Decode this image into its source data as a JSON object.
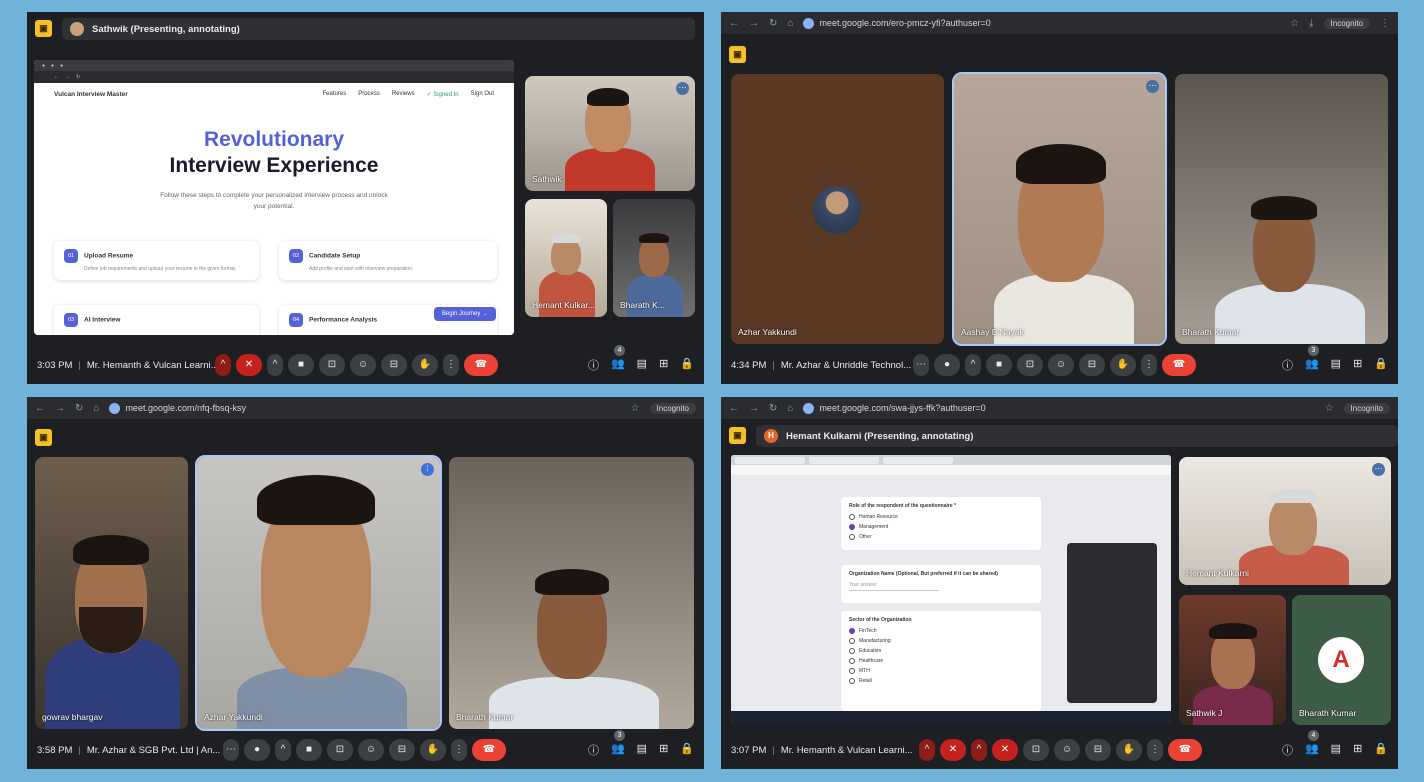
{
  "q1": {
    "presenter_label": "Sathwik (Presenting, annotating)",
    "shared_screen": {
      "brand": "Vulcan Interview Master",
      "nav_links": [
        "Features",
        "Process",
        "Reviews",
        "✓ Signed In",
        "Sign Out"
      ],
      "hero_line1": "Revolutionary",
      "hero_line2": "Interview Experience",
      "subtitle": "Follow these steps to complete your personalized interview process and unlock your potential.",
      "cards": [
        {
          "num": "01",
          "title": "Upload Resume",
          "desc": "Define job requirements and upload your resume in the given format."
        },
        {
          "num": "02",
          "title": "Candidate Setup",
          "desc": "Add profile and start with interview preparation."
        },
        {
          "num": "03",
          "title": "AI Interview",
          "desc": ""
        },
        {
          "num": "04",
          "title": "Performance Analysis",
          "desc": ""
        }
      ],
      "begin_button": "Begin Journey →"
    },
    "tiles": [
      "Sathwik",
      "Hemant Kulkar...",
      "Bharath K..."
    ],
    "time": "3:03 PM",
    "meeting_title": "Mr. Hemanth & Vulcan Learni...",
    "participants_count": "4"
  },
  "q2": {
    "url": "meet.google.com/ero-pmcz-yfi?authuser=0",
    "incognito": "Incognito",
    "tiles": [
      "Azhar Yakkundi",
      "Aashay B Nayak",
      "Bharath Kumar"
    ],
    "time": "4:34 PM",
    "meeting_title": "Mr. Azhar & Unriddle Technol...",
    "participants_count": "3"
  },
  "q3": {
    "url": "meet.google.com/nfq-fbsq-ksy",
    "incognito": "Incognito",
    "tiles": [
      "gowrav bhargav",
      "Azhar Yakkundi",
      "Bharath Kumar"
    ],
    "time": "3:58 PM",
    "meeting_title": "Mr. Azhar & SGB Pvt. Ltd | An...",
    "participants_count": "3"
  },
  "q4": {
    "url": "meet.google.com/swa-jjys-ffk?authuser=0",
    "incognito": "Incognito",
    "presenter_label": "Hemant Kulkarni (Presenting, annotating)",
    "presenter_initial": "H",
    "form": {
      "q_role": "Role of the respondent of the questionnaire *",
      "roles": [
        "Human Resource",
        "Management",
        "Other"
      ],
      "q_org": "Organization Name (Optional, But preferred if it can be shared)",
      "org_placeholder": "Your answer",
      "q_sector": "Sector of the Organization",
      "sectors": [
        "FinTech",
        "Manufacturing",
        "Education",
        "Healthcare",
        "MTH",
        "Retail"
      ]
    },
    "tiles": [
      "Hemant Kulkarni",
      "Sathwik J",
      "Bharath Kumar"
    ],
    "time": "3:07 PM",
    "meeting_title": "Mr. Hemanth & Vulcan Learni...",
    "participants_count": "4"
  },
  "icons": {
    "mic_off": "🎙",
    "mic": "🎙",
    "camera": "▭",
    "present": "⊡",
    "emoji": "☺",
    "captions": "⊟",
    "hand": "✋",
    "more": "⋮",
    "end": "☎",
    "info": "ⓘ",
    "people": "👥",
    "chat": "▤",
    "apps": "⊞",
    "lock": "🔒"
  }
}
